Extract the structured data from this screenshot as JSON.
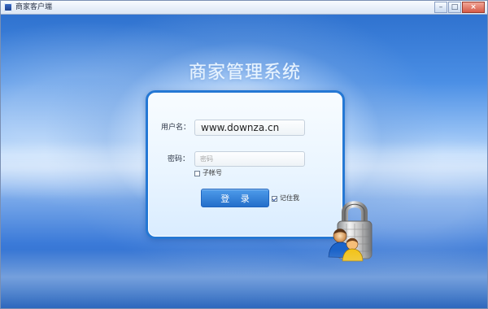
{
  "window": {
    "title": "商家客户端",
    "controls": {
      "minimize": "–",
      "maximize": "□",
      "close": "×"
    }
  },
  "login": {
    "system_title": "商家管理系统",
    "username_label": "用户名：",
    "username_value": "www.downza.cn",
    "password_label": "密码：",
    "password_placeholder": "密码",
    "subaccount_label": "子帐号",
    "login_button": "登 录",
    "remember_label": "记住我"
  },
  "colors": {
    "panel_border": "#2578d4",
    "button": "#246fca",
    "background_blue": "#3b7ad8"
  },
  "icons": {
    "app": "app-icon",
    "login_art": "lock-users-icon"
  }
}
